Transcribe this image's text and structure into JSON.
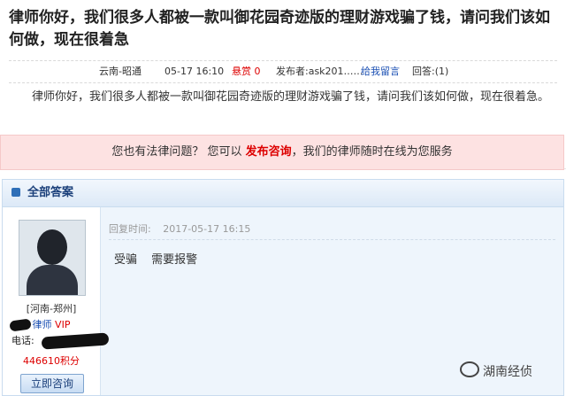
{
  "question": {
    "title": "律师你好，我们很多人都被一款叫御花园奇迹版的理财游戏骗了钱，请问我们该如何做，现在很着急",
    "location": "云南-昭通",
    "date": "05-17 16:10",
    "reward_label": "悬赏 0",
    "publisher": "发布者:ask201……",
    "leave_message": "给我留言",
    "answer_count": "回答:(1)",
    "body": "律师你好，我们很多人都被一款叫御花园奇迹版的理财游戏骗了钱，请问我们该如何做，现在很着急。"
  },
  "consult_bar": {
    "prefix": "您也有法律问题？ 您可以",
    "link": "发布咨询",
    "suffix": "，我们的律师随时在线为您服务"
  },
  "answers": {
    "header": "全部答案",
    "lawyer": {
      "region": "[河南-郑州]",
      "title": "律师",
      "vip": "VIP",
      "phone_label": "电话:",
      "points": "446610积分",
      "consult_button": "立即咨询"
    },
    "reply": {
      "time_label": "回复时间:",
      "time": "2017-05-17 16:15",
      "text": "受骗 需要报警"
    }
  },
  "watermark": "湖南经侦",
  "colors": {
    "red_accent": "#dd0000",
    "link_blue": "#1a4fb3",
    "consult_bar_bg": "#fde2e2",
    "answer_panel_bg": "#eef5fc"
  }
}
